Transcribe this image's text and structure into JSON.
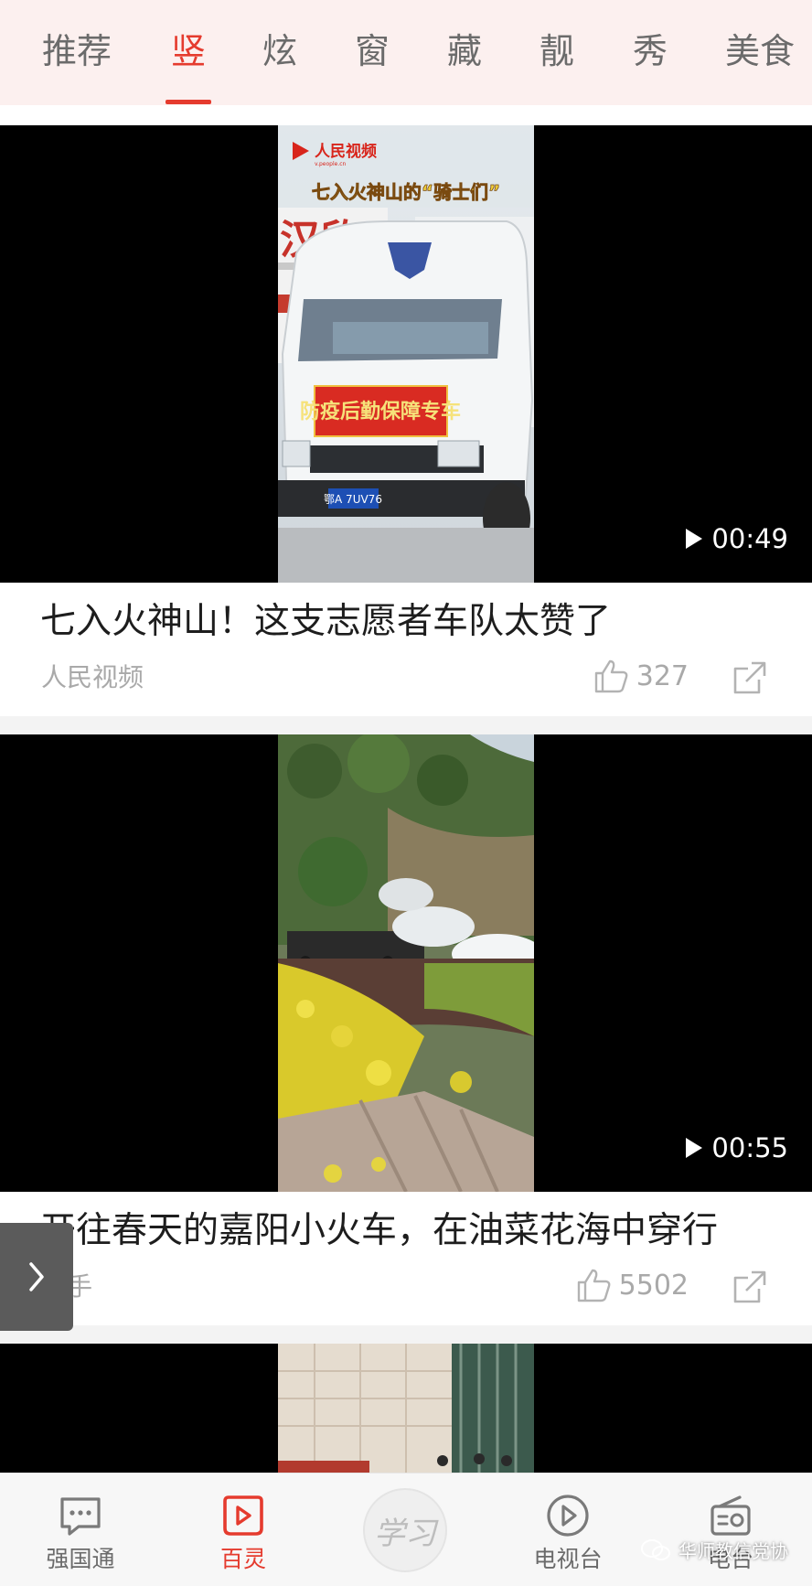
{
  "colors": {
    "accent": "#e53b2e",
    "topbar_bg": "#fcf0ef",
    "muted": "#a9a9a9"
  },
  "tabs": [
    {
      "label": "推荐",
      "active": false
    },
    {
      "label": "竖",
      "active": true
    },
    {
      "label": "炫",
      "active": false
    },
    {
      "label": "窗",
      "active": false
    },
    {
      "label": "藏",
      "active": false
    },
    {
      "label": "靓",
      "active": false
    },
    {
      "label": "秀",
      "active": false
    },
    {
      "label": "美食",
      "active": false
    }
  ],
  "feed": [
    {
      "duration": "00:49",
      "title": "七入火神山！这支志愿者车队太赞了",
      "source": "人民视频",
      "likes": "327",
      "frame_text": {
        "logo": "人民视频",
        "logo_sub": "v.people.cn",
        "banner": "七入火神山的“骑士们”",
        "sign": "汉欣",
        "truck_banner": "防疫后勤保障专车",
        "plate": "鄂A 7UV76"
      }
    },
    {
      "duration": "00:55",
      "title": "开往春天的嘉阳小火车，在油菜花海中穿行",
      "source": "快手",
      "likes": "5502"
    }
  ],
  "bottom_nav": [
    {
      "label": "强国通",
      "icon": "chat-icon",
      "active": false
    },
    {
      "label": "百灵",
      "icon": "play-bubble-icon",
      "active": true
    },
    {
      "label": "学习",
      "icon": "study-logo",
      "active": false
    },
    {
      "label": "电视台",
      "icon": "tv-play-icon",
      "active": false
    },
    {
      "label": "电台",
      "icon": "radio-icon",
      "active": false
    }
  ],
  "watermark": "华师教信党协"
}
